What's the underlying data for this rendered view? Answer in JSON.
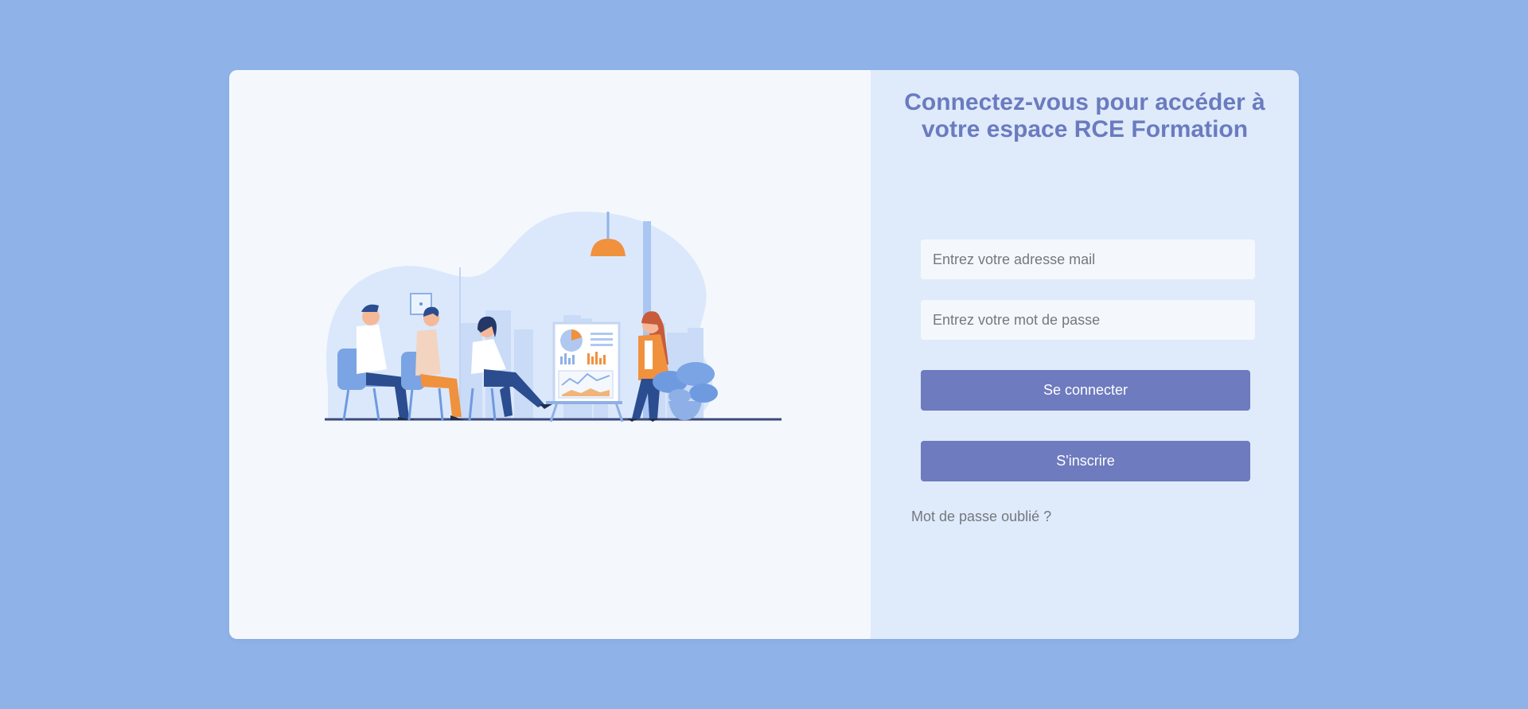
{
  "login": {
    "title_line1": "Connectez-vous pour accéder à",
    "title_line2": "votre espace RCE Formation",
    "email_placeholder": "Entrez votre adresse mail",
    "password_placeholder": "Entrez votre mot de passe",
    "login_button": "Se connecter",
    "signup_button": "S'inscrire",
    "forgot_link": "Mot de passe oublié ?"
  },
  "illustration": {
    "icon": "training-meeting-illustration"
  },
  "colors": {
    "page_background": "#8fb2e8",
    "illustration_panel": "#f4f8fd",
    "form_panel": "#dfebfb",
    "accent": "#6e7bbf",
    "title": "#6b7bbf",
    "illustration_orange": "#f0913e",
    "illustration_navy": "#2b4d8f"
  }
}
